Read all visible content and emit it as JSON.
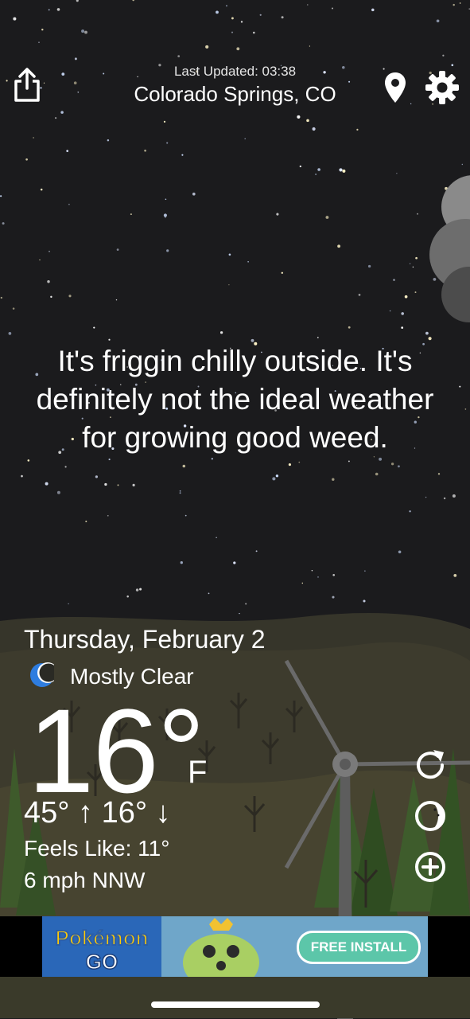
{
  "header": {
    "last_updated": "Last Updated: 03:38",
    "location": "Colorado Springs, CO"
  },
  "message": "It's friggin chilly outside. It's definitely not the ideal weather for growing good weed.",
  "weather": {
    "date": "Thursday, February 2",
    "condition": "Mostly Clear",
    "temperature": "16°",
    "unit": "F",
    "high_low": "45° ↑  16° ↓",
    "feels_like": "Feels Like: 11°",
    "wind": "6 mph NNW"
  },
  "ad": {
    "cta": "FREE INSTALL",
    "logo_text": "Pokémon GO"
  },
  "icons": {
    "share": "share-icon",
    "location": "location-pin-icon",
    "settings": "gear-icon",
    "refresh": "refresh-icon",
    "moon_phase": "moon-phase-icon",
    "add": "plus-circle-icon",
    "condition": "crescent-moon-icon"
  },
  "colors": {
    "sky": "#1b1b1d",
    "hill_far": "#3b3a2e",
    "hill_near": "#4a4731",
    "tree": "#3e5a2b",
    "ad_button": "#5cc6a9",
    "moon": "#2e7de0"
  }
}
